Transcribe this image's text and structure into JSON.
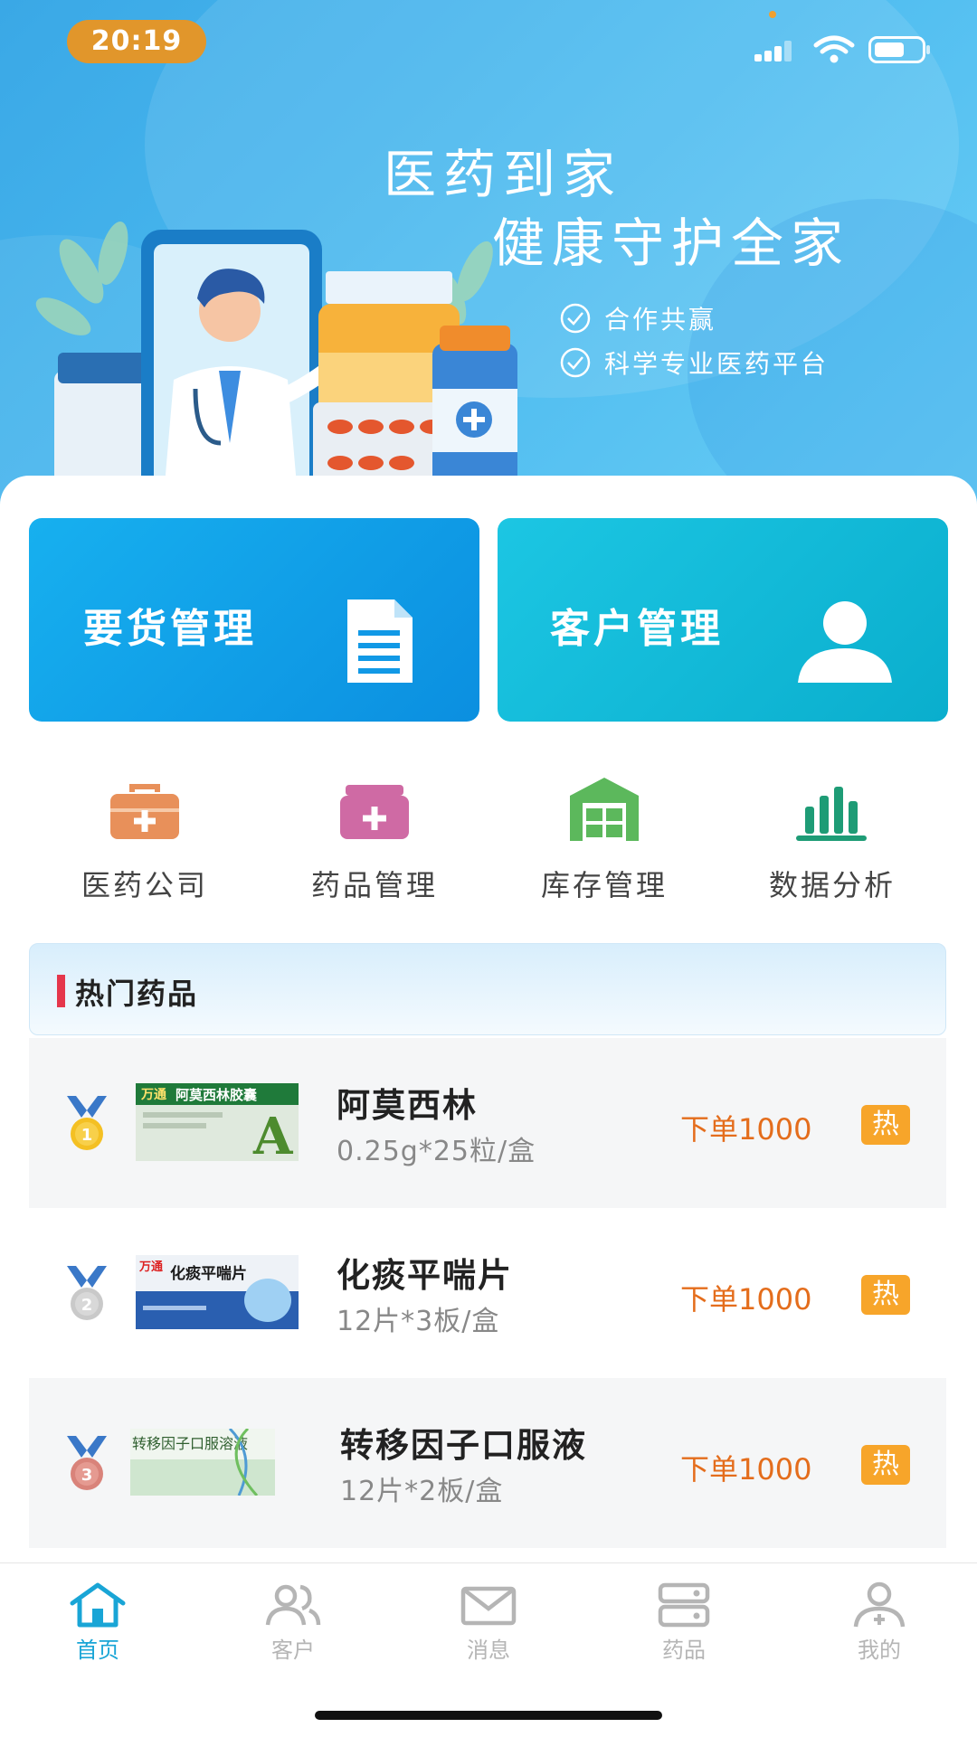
{
  "status_bar": {
    "time": "20:19"
  },
  "hero": {
    "title_line1": "医药到家",
    "title_line2": "健康守护全家",
    "checks": [
      "合作共赢",
      "科学专业医药平台"
    ]
  },
  "main_cards": [
    {
      "label": "要货管理",
      "icon": "document-icon",
      "color_from": "#17b0ef",
      "color_to": "#0b8fe0"
    },
    {
      "label": "客户管理",
      "icon": "user-icon",
      "color_from": "#1cc6e3",
      "color_to": "#0aaecd"
    }
  ],
  "quick_actions": [
    {
      "label": "医药公司",
      "icon": "medical-kit-icon",
      "color": "#e8905a"
    },
    {
      "label": "药品管理",
      "icon": "medicine-box-icon",
      "color": "#cf6aa4"
    },
    {
      "label": "库存管理",
      "icon": "warehouse-icon",
      "color": "#5cb85c"
    },
    {
      "label": "数据分析",
      "icon": "bar-chart-icon",
      "color": "#1e9c76"
    }
  ],
  "hot_section": {
    "title": "热门药品",
    "items": [
      {
        "rank": "1",
        "name": "阿莫西林",
        "spec": "0.25g*25粒/盒",
        "order": "下单1000",
        "badge": "热",
        "pack_brand": "万通",
        "pack_title": "阿莫西林胶囊",
        "pack_letter": "A"
      },
      {
        "rank": "2",
        "name": "化痰平喘片",
        "spec": "12片*3板/盒",
        "order": "下单1000",
        "badge": "热",
        "pack_brand": "万通",
        "pack_title": "化痰平喘片"
      },
      {
        "rank": "3",
        "name": "转移因子口服液",
        "spec": "12片*2板/盒",
        "order": "下单1000",
        "badge": "热",
        "pack_title": "转移因子口服溶液"
      }
    ]
  },
  "tab_bar": {
    "active_color": "#19a5d6",
    "items": [
      {
        "label": "首页",
        "icon": "home-icon",
        "active": true
      },
      {
        "label": "客户",
        "icon": "users-icon",
        "active": false
      },
      {
        "label": "消息",
        "icon": "mail-icon",
        "active": false
      },
      {
        "label": "药品",
        "icon": "pill-box-icon",
        "active": false
      },
      {
        "label": "我的",
        "icon": "profile-icon",
        "active": false
      }
    ]
  }
}
